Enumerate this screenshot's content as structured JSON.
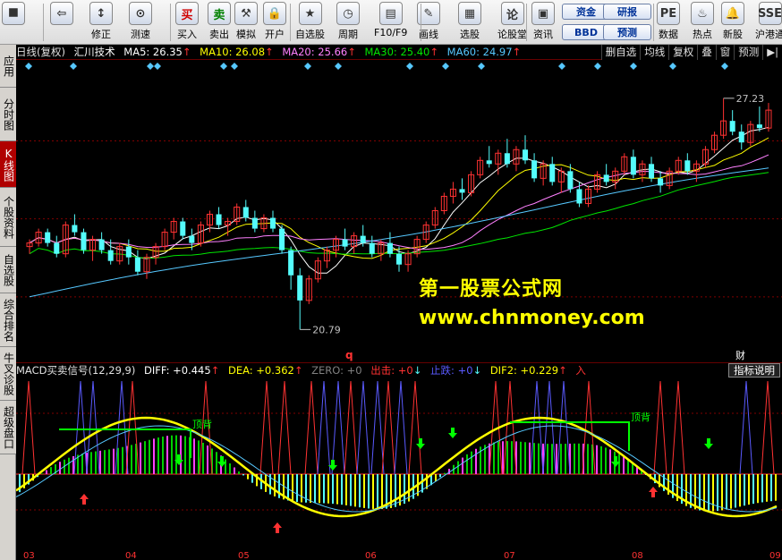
{
  "toolbar": {
    "buttons": [
      {
        "label": "",
        "icon": "⯀",
        "name": "windows-grid-icon"
      },
      {
        "label": "",
        "icon": "⇦",
        "name": "back-arrow-icon"
      },
      {
        "label": "修正",
        "icon": "↕",
        "name": "adjust-button"
      },
      {
        "label": "测速",
        "icon": "⊙",
        "name": "speed-test-button"
      },
      {
        "label": "买入",
        "icon": "买",
        "name": "buy-button"
      },
      {
        "label": "卖出",
        "icon": "卖",
        "name": "sell-button"
      },
      {
        "label": "模拟",
        "icon": "⚒",
        "name": "simulate-button"
      },
      {
        "label": "开户",
        "icon": "🔒",
        "name": "open-account-button"
      },
      {
        "label": "自选股",
        "icon": "★",
        "name": "watchlist-button"
      },
      {
        "label": "周期",
        "icon": "◷",
        "name": "period-button"
      },
      {
        "label": "F10/F9",
        "icon": "▤",
        "name": "f10-button"
      },
      {
        "label": "画线",
        "icon": "✎",
        "name": "draw-line-button"
      },
      {
        "label": "选股",
        "icon": "▦",
        "name": "stock-select-button"
      },
      {
        "label": "论股堂",
        "icon": "论",
        "name": "forum-button"
      },
      {
        "label": "资讯",
        "icon": "▣",
        "name": "news-button"
      },
      {
        "label": "数据",
        "icon": "PE",
        "name": "data-button"
      },
      {
        "label": "热点",
        "icon": "♨",
        "name": "hotspot-button"
      },
      {
        "label": "新股",
        "icon": "🔔",
        "name": "new-stock-button"
      },
      {
        "label": "沪港通",
        "icon": "SSE",
        "name": "hk-connect-button"
      }
    ],
    "pills": [
      {
        "label": "资金",
        "name": "fund-pill"
      },
      {
        "label": "BBD",
        "name": "bbd-pill"
      },
      {
        "label": "研报",
        "name": "research-pill"
      },
      {
        "label": "预测",
        "name": "forecast-pill"
      }
    ]
  },
  "left_tabs": [
    {
      "label": "应用",
      "active": false
    },
    {
      "label": "分时图",
      "active": false
    },
    {
      "label": "K线图",
      "active": true
    },
    {
      "label": "个股资料",
      "active": false
    },
    {
      "label": "自选股",
      "active": false
    },
    {
      "label": "综合排名",
      "active": false
    },
    {
      "label": "牛叉诊股",
      "active": false
    },
    {
      "label": "超级盘口",
      "active": false
    }
  ],
  "info": {
    "period": "日线(复权)",
    "stock_name": "汇川技术",
    "ma5": "MA5: 26.35",
    "ma10": "MA10: 26.08",
    "ma20": "MA20: 25.66",
    "ma30": "MA30: 25.40",
    "ma60": "MA60: 24.97",
    "up_arrow": "↑"
  },
  "right_controls": [
    "删自选",
    "均线",
    "复权",
    "叠",
    "窗",
    "预测",
    "▶|"
  ],
  "annotations": {
    "high": "27.23",
    "low": "20.79",
    "q_marker": "q",
    "cai_marker": "财",
    "divergence1": "顶背",
    "divergence2": "顶背"
  },
  "watermark": {
    "line1": "第一股票公式网",
    "line2": "www.chnmoney.com"
  },
  "indicator": {
    "name": "MACD买卖信号(12,29,9)",
    "diff": "DIFF: +0.445",
    "dea": "DEA: +0.362",
    "zero": "ZERO: +0",
    "chuji": "出击: +0",
    "zhidie": "止跌: +0",
    "dif2": "DIF2: +0.229",
    "ru": "入",
    "button": "指标说明"
  },
  "x_axis_labels": [
    "03",
    "04",
    "05",
    "06",
    "07",
    "08",
    "09"
  ],
  "colors": {
    "up": "#ff3232",
    "down": "#54fcfc",
    "ma5": "#ffffff",
    "ma10": "#ffff00",
    "ma20": "#ff80ff",
    "ma30": "#00e600",
    "ma60": "#56c8ff",
    "grid": "#800000"
  },
  "chart_data": {
    "type": "candlestick",
    "price_range": [
      20.5,
      27.6
    ],
    "high": 27.23,
    "low": 20.79,
    "ohlc": [
      [
        23.1,
        23.3,
        22.9,
        23.2
      ],
      [
        23.2,
        23.6,
        23.1,
        23.5
      ],
      [
        23.5,
        23.6,
        23.1,
        23.2
      ],
      [
        23.2,
        23.4,
        22.8,
        22.9
      ],
      [
        22.9,
        23.8,
        22.8,
        23.7
      ],
      [
        23.7,
        24.0,
        23.4,
        23.5
      ],
      [
        23.5,
        23.6,
        22.9,
        23.0
      ],
      [
        23.0,
        23.4,
        22.7,
        23.3
      ],
      [
        23.3,
        23.5,
        22.9,
        23.0
      ],
      [
        23.0,
        23.3,
        22.6,
        22.7
      ],
      [
        22.7,
        23.2,
        22.6,
        23.1
      ],
      [
        23.1,
        23.3,
        22.6,
        22.8
      ],
      [
        22.8,
        23.0,
        22.3,
        22.4
      ],
      [
        22.4,
        22.9,
        22.2,
        22.8
      ],
      [
        22.8,
        23.2,
        22.6,
        23.1
      ],
      [
        23.1,
        23.6,
        23.0,
        23.5
      ],
      [
        23.5,
        23.9,
        23.3,
        23.8
      ],
      [
        23.8,
        23.9,
        23.3,
        23.4
      ],
      [
        23.4,
        23.6,
        23.0,
        23.2
      ],
      [
        23.2,
        23.8,
        23.1,
        23.7
      ],
      [
        23.7,
        24.1,
        23.5,
        24.0
      ],
      [
        24.0,
        24.2,
        23.6,
        23.7
      ],
      [
        23.7,
        23.9,
        23.4,
        23.8
      ],
      [
        23.8,
        24.3,
        23.7,
        24.2
      ],
      [
        24.2,
        24.4,
        23.8,
        23.9
      ],
      [
        23.9,
        24.1,
        23.5,
        23.6
      ],
      [
        23.6,
        24.0,
        23.5,
        23.9
      ],
      [
        23.9,
        24.1,
        23.5,
        23.6
      ],
      [
        23.6,
        23.7,
        22.9,
        23.0
      ],
      [
        23.0,
        23.1,
        21.9,
        22.3
      ],
      [
        22.3,
        22.5,
        20.79,
        21.6
      ],
      [
        21.6,
        22.3,
        21.5,
        22.2
      ],
      [
        22.2,
        22.8,
        22.1,
        22.7
      ],
      [
        22.7,
        23.1,
        22.5,
        23.0
      ],
      [
        23.0,
        23.4,
        22.8,
        23.3
      ],
      [
        23.3,
        23.6,
        23.0,
        23.1
      ],
      [
        23.1,
        23.5,
        22.9,
        23.4
      ],
      [
        23.4,
        23.7,
        23.1,
        23.2
      ],
      [
        23.2,
        23.4,
        22.8,
        22.9
      ],
      [
        22.9,
        23.3,
        22.7,
        23.2
      ],
      [
        23.2,
        23.5,
        22.8,
        22.9
      ],
      [
        22.9,
        23.1,
        22.4,
        22.6
      ],
      [
        22.6,
        23.0,
        22.4,
        22.9
      ],
      [
        22.9,
        23.4,
        22.8,
        23.3
      ],
      [
        23.3,
        23.8,
        23.2,
        23.7
      ],
      [
        23.7,
        24.2,
        23.6,
        24.1
      ],
      [
        24.1,
        24.6,
        24.0,
        24.5
      ],
      [
        24.5,
        24.9,
        24.3,
        24.7
      ],
      [
        24.7,
        25.0,
        24.4,
        24.6
      ],
      [
        24.6,
        25.2,
        24.5,
        25.1
      ],
      [
        25.1,
        25.6,
        25.0,
        25.5
      ],
      [
        25.5,
        25.9,
        25.3,
        25.4
      ],
      [
        25.4,
        25.8,
        25.1,
        25.7
      ],
      [
        25.7,
        26.1,
        25.3,
        25.4
      ],
      [
        25.4,
        25.9,
        25.2,
        25.8
      ],
      [
        25.8,
        26.2,
        25.4,
        25.5
      ],
      [
        25.5,
        25.7,
        24.9,
        25.0
      ],
      [
        25.0,
        25.5,
        24.8,
        25.4
      ],
      [
        25.4,
        25.6,
        24.8,
        24.9
      ],
      [
        24.9,
        25.3,
        24.6,
        25.2
      ],
      [
        25.2,
        25.4,
        24.6,
        24.7
      ],
      [
        24.7,
        24.9,
        24.2,
        24.3
      ],
      [
        24.3,
        24.8,
        24.2,
        24.7
      ],
      [
        24.7,
        25.2,
        24.6,
        25.1
      ],
      [
        25.1,
        25.4,
        24.8,
        24.9
      ],
      [
        24.9,
        25.3,
        24.7,
        25.2
      ],
      [
        25.2,
        25.7,
        25.1,
        25.6
      ],
      [
        25.6,
        25.8,
        25.0,
        25.1
      ],
      [
        25.1,
        25.5,
        24.9,
        25.4
      ],
      [
        25.4,
        25.6,
        24.9,
        25.0
      ],
      [
        25.0,
        25.2,
        24.6,
        24.8
      ],
      [
        24.8,
        25.3,
        24.7,
        25.2
      ],
      [
        25.2,
        25.6,
        25.1,
        25.5
      ],
      [
        25.5,
        25.7,
        25.1,
        25.2
      ],
      [
        25.2,
        25.5,
        24.9,
        25.4
      ],
      [
        25.4,
        25.9,
        25.3,
        25.8
      ],
      [
        25.8,
        26.3,
        25.7,
        26.2
      ],
      [
        26.2,
        27.23,
        26.1,
        26.6
      ],
      [
        26.6,
        26.9,
        26.2,
        26.3
      ],
      [
        26.3,
        26.5,
        25.8,
        26.0
      ],
      [
        26.0,
        26.6,
        25.9,
        26.5
      ],
      [
        26.5,
        27.0,
        26.3,
        26.4
      ],
      [
        26.4,
        27.1,
        26.3,
        26.9
      ]
    ]
  }
}
